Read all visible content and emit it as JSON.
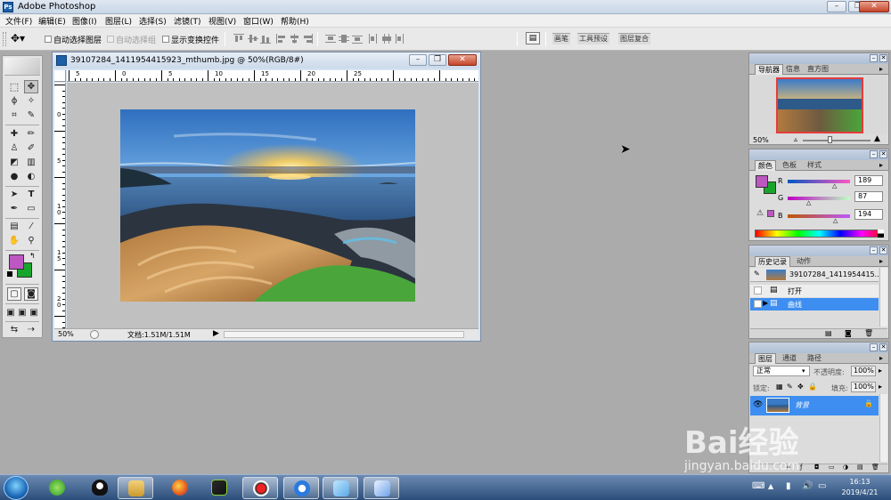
{
  "window": {
    "title": "Adobe Photoshop"
  },
  "menu": [
    "文件(F)",
    "编辑(E)",
    "图像(I)",
    "图层(L)",
    "选择(S)",
    "滤镜(T)",
    "视图(V)",
    "窗口(W)",
    "帮助(H)"
  ],
  "options": {
    "auto_select_layer": "自动选择图层",
    "auto_select_group": "自动选择组",
    "show_transform": "显示变换控件",
    "wells": [
      "画笔",
      "工具预设",
      "图层复合"
    ]
  },
  "document": {
    "title": "39107284_1411954415923_mthumb.jpg @ 50%(RGB/8#)",
    "zoom": "50%",
    "doc_size": "文档:1.51M/1.51M",
    "ruler_h": [
      "5",
      "0",
      "5",
      "10",
      "15",
      "20",
      "25"
    ],
    "ruler_v": [
      "0",
      "5",
      "1\n0",
      "1\n5",
      "2\n0"
    ]
  },
  "navigator": {
    "tabs": [
      "导航器",
      "信息",
      "直方图"
    ],
    "zoom": "50%"
  },
  "color": {
    "tabs": [
      "颜色",
      "色板",
      "样式"
    ],
    "channels": [
      {
        "label": "R",
        "value": "189"
      },
      {
        "label": "G",
        "value": "87"
      },
      {
        "label": "B",
        "value": "194"
      }
    ],
    "fg": "#bd57c2",
    "bg": "#18a52b"
  },
  "history": {
    "tabs": [
      "历史记录",
      "动作"
    ],
    "snapshot": "39107284_1411954415...",
    "items": [
      "打开",
      "曲线"
    ]
  },
  "layers": {
    "tabs": [
      "图层",
      "通道",
      "路径"
    ],
    "blend_mode": "正常",
    "opacity_label": "不透明度:",
    "opacity": "100%",
    "lock_label": "锁定:",
    "fill_label": "填充:",
    "fill": "100%",
    "layer_name": "背景"
  },
  "taskbar": {
    "time": "16:13",
    "date": "2019/4/21"
  },
  "watermark": {
    "text": "Bai经验",
    "url": "jingyan.baidu.com"
  }
}
